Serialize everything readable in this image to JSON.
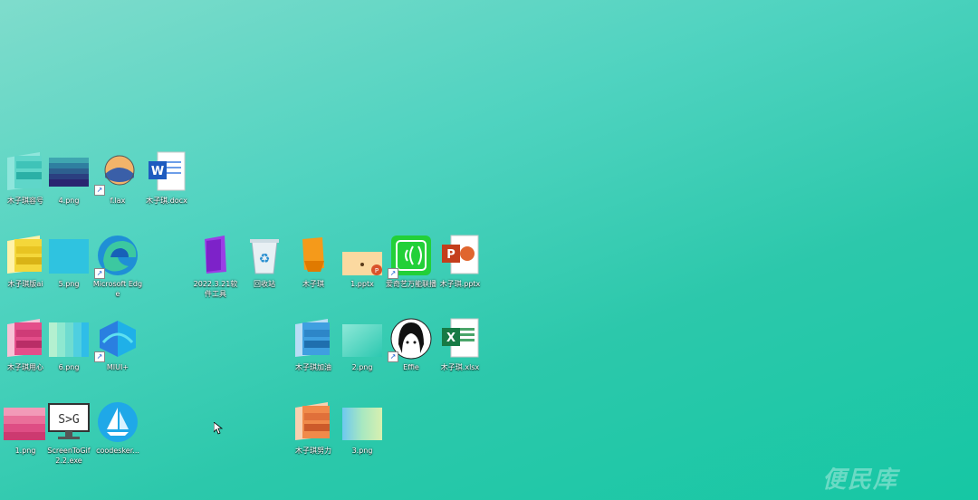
{
  "desktop": {
    "icons": [
      {
        "label": "木子琪容号"
      },
      {
        "label": "4.png"
      },
      {
        "label": "f.lax"
      },
      {
        "label": "木子琪.docx"
      },
      {
        "label": "木子琪版ai"
      },
      {
        "label": "5.png"
      },
      {
        "label": "Microsoft Edge"
      },
      {
        "label": "2022.3.21软件工具"
      },
      {
        "label": "回收站"
      },
      {
        "label": "木子琪"
      },
      {
        "label": "1.pptx"
      },
      {
        "label": "爱奇艺万能联播"
      },
      {
        "label": "木子琪.pptx"
      },
      {
        "label": "木子琪用心"
      },
      {
        "label": "6.png"
      },
      {
        "label": "MIUI+"
      },
      {
        "label": "木子琪加油"
      },
      {
        "label": "2.png"
      },
      {
        "label": "Effie"
      },
      {
        "label": "木子琪.xlsx"
      },
      {
        "label": "1.png"
      },
      {
        "label": "ScreenToGif 2.2.exe"
      },
      {
        "label": "coodesker..."
      },
      {
        "label": "木子琪努力"
      },
      {
        "label": "3.png"
      }
    ],
    "watermark": "便民库"
  }
}
